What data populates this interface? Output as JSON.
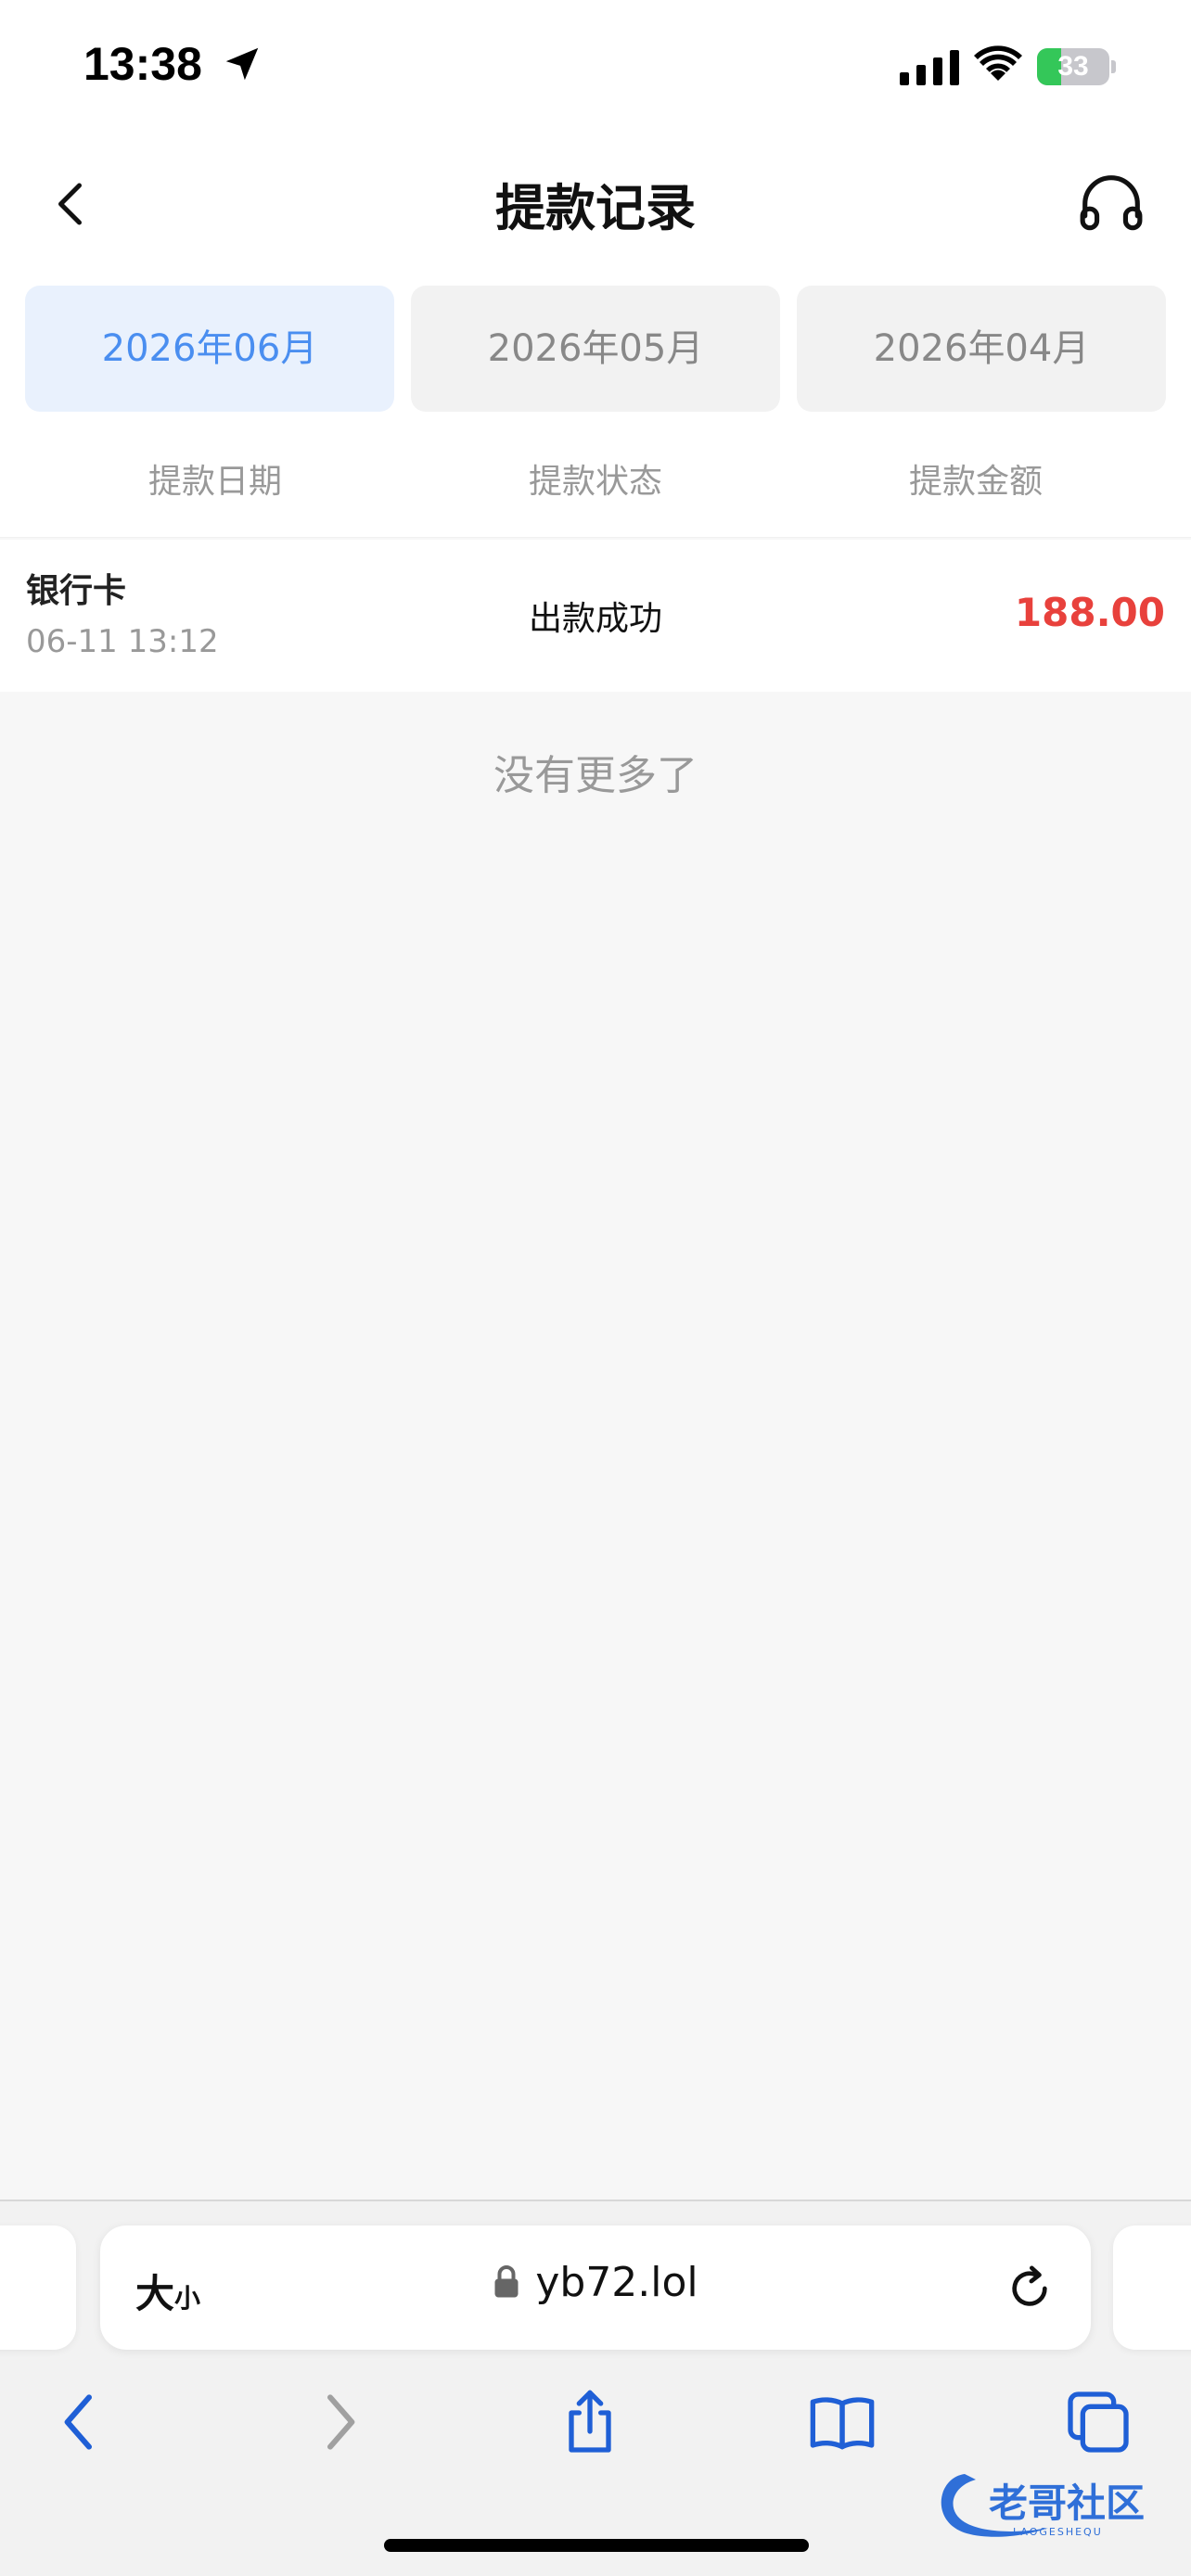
{
  "status_bar": {
    "time": "13:38",
    "battery_percent": "33",
    "battery_level": 0.33,
    "icons": [
      "location-arrow-icon",
      "signal-icon",
      "wifi-icon",
      "battery-icon"
    ]
  },
  "nav": {
    "title": "提款记录",
    "back_icon": "chevron-left-icon",
    "support_icon": "headphones-icon"
  },
  "month_tabs": [
    {
      "label": "2026年06月",
      "active": true
    },
    {
      "label": "2026年05月",
      "active": false
    },
    {
      "label": "2026年04月",
      "active": false
    }
  ],
  "columns": [
    "提款日期",
    "提款状态",
    "提款金额"
  ],
  "records": [
    {
      "method": "银行卡",
      "time": "06-11 13:12",
      "status": "出款成功",
      "amount": "188.00"
    }
  ],
  "empty_text": "没有更多了",
  "safari": {
    "text_size_big": "大",
    "text_size_small": "小",
    "url": "yb72.lol"
  },
  "watermark": {
    "text": "老哥社区",
    "subtext": "LAOGESHEQU"
  },
  "colors": {
    "accent": "#4a8ef0",
    "active_tab_bg": "#e9f1fd",
    "amount": "#e8413c",
    "battery": "#34c759",
    "safari_blue": "#1f5fd6"
  }
}
